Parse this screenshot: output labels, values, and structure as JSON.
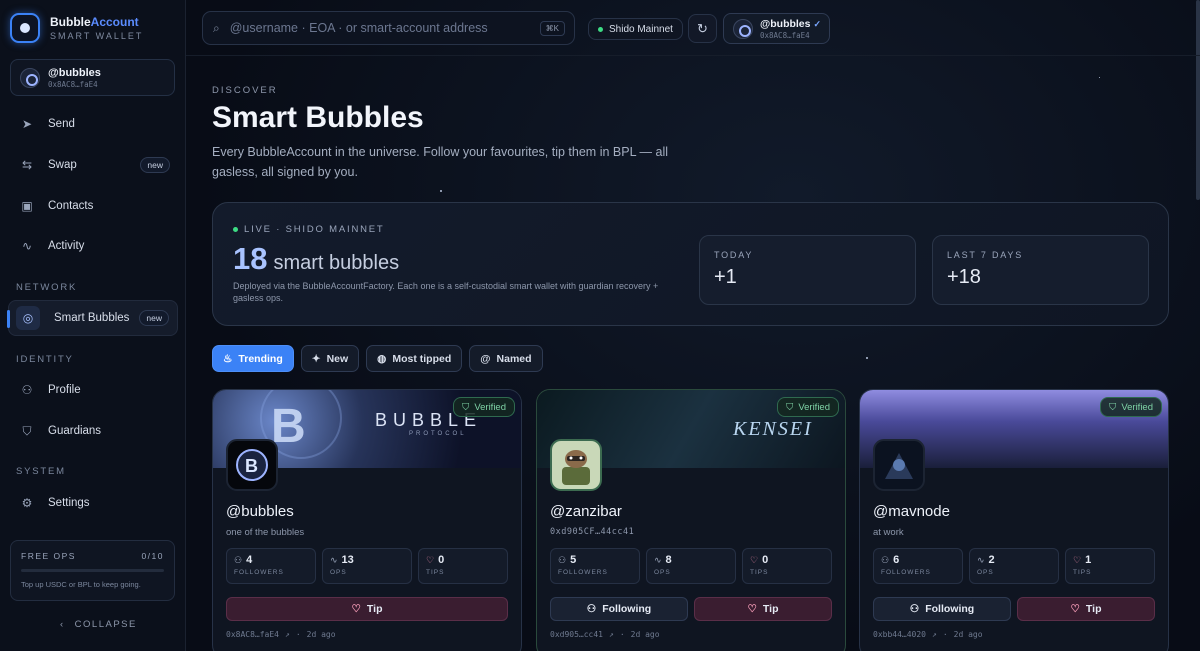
{
  "brand": {
    "name_a": "Bubble",
    "name_b": "Account",
    "sub": "SMART WALLET"
  },
  "user": {
    "handle": "@bubbles",
    "address": "0x8AC8…faE4"
  },
  "nav": {
    "send": "Send",
    "swap": "Swap",
    "swap_badge": "new",
    "contacts": "Contacts",
    "activity": "Activity",
    "network_section": "NETWORK",
    "smart_bubbles": "Smart Bubbles",
    "smart_bubbles_badge": "new",
    "identity_section": "IDENTITY",
    "profile": "Profile",
    "guardians": "Guardians",
    "system_section": "SYSTEM",
    "settings": "Settings"
  },
  "free_ops": {
    "label": "FREE OPS",
    "count": "0/10",
    "used_fraction": 0,
    "hint": "Top up USDC or BPL to keep going."
  },
  "collapse_label": "COLLAPSE",
  "topbar": {
    "search_placeholder": "@username · EOA · or smart-account address",
    "shortcut": "⌘K",
    "network": "Shido Mainnet",
    "user_handle": "@bubbles",
    "user_address": "0x8AC8…faE4"
  },
  "page": {
    "eyebrow": "DISCOVER",
    "title": "Smart Bubbles",
    "description": "Every BubbleAccount in the universe. Follow your favourites, tip them in BPL — all gasless, all signed by you."
  },
  "stats": {
    "live": "LIVE · SHIDO MAINNET",
    "count": "18",
    "count_label": "smart bubbles",
    "description": "Deployed via the BubbleAccountFactory. Each one is a self-custodial smart wallet with guardian recovery + gasless ops.",
    "today_label": "TODAY",
    "today_value": "+1",
    "week_label": "LAST 7 DAYS",
    "week_value": "+18"
  },
  "filters": [
    "Trending",
    "New",
    "Most tipped",
    "Named"
  ],
  "colors": {
    "accent": "#3b82f6",
    "verified": "#7fd3a6",
    "tip": "#f39ab5",
    "live_dot": "#3ddc84"
  },
  "cards": [
    {
      "banner_text": "BUBBLE",
      "banner_sub": "PROTOCOL",
      "verified": "Verified",
      "handle": "@bubbles",
      "subtitle": "one of the bubbles",
      "followers": "4",
      "followers_label": "FOLLOWERS",
      "ops": "13",
      "ops_label": "OPS",
      "tips": "0",
      "tips_label": "TIPS",
      "tip_label": "Tip",
      "address": "0x8AC8…faE4",
      "age": "2d ago"
    },
    {
      "banner_text": "KENSEI",
      "verified": "Verified",
      "handle": "@zanzibar",
      "subtitle": "0xd905CF…44cc41",
      "followers": "5",
      "followers_label": "FOLLOWERS",
      "ops": "8",
      "ops_label": "OPS",
      "tips": "0",
      "tips_label": "TIPS",
      "following_label": "Following",
      "tip_label": "Tip",
      "address": "0xd905…cc41",
      "age": "2d ago"
    },
    {
      "verified": "Verified",
      "handle": "@mavnode",
      "subtitle": "at work",
      "followers": "6",
      "followers_label": "FOLLOWERS",
      "ops": "2",
      "ops_label": "OPS",
      "tips": "1",
      "tips_label": "TIPS",
      "following_label": "Following",
      "tip_label": "Tip",
      "address": "0xbb44…4020",
      "age": "2d ago"
    }
  ]
}
